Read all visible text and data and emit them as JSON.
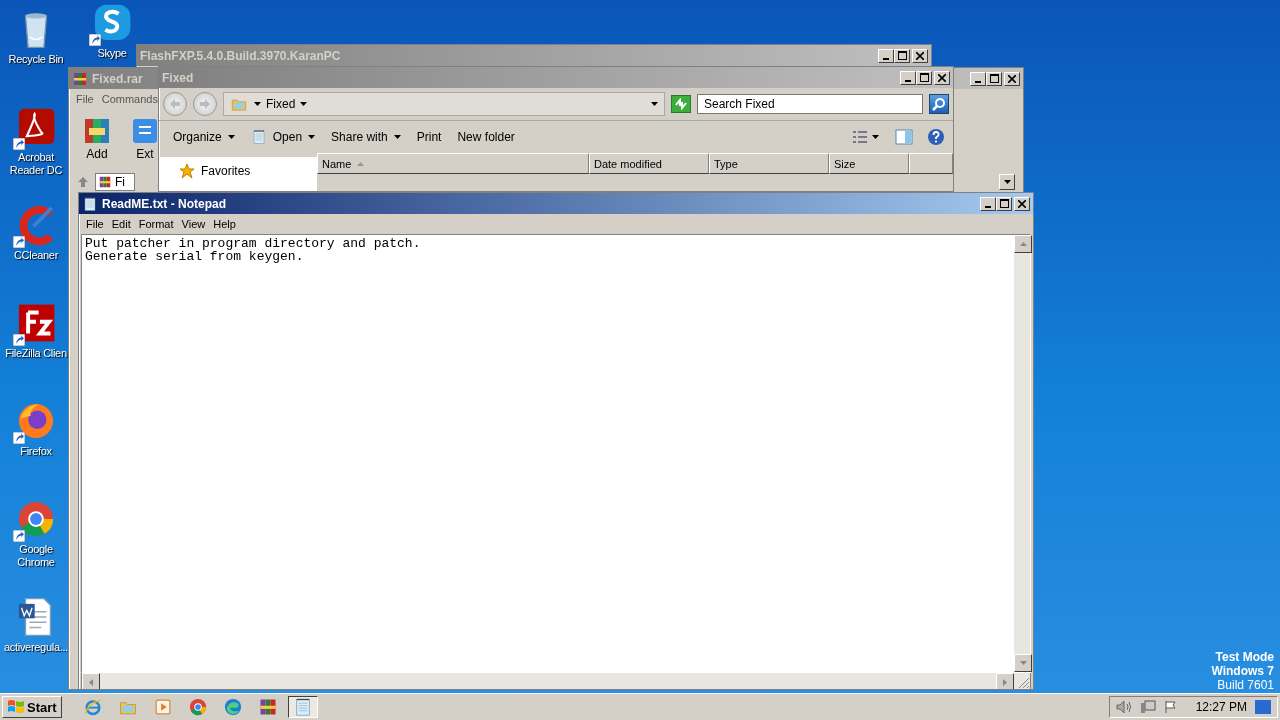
{
  "desktop_icons": [
    {
      "label": "Recycle Bin",
      "kind": "recycle-bin",
      "shortcut": false
    },
    {
      "label": "Skype",
      "kind": "skype",
      "shortcut": true
    },
    {
      "label": "Acrobat Reader DC",
      "kind": "acrobat",
      "shortcut": true
    },
    {
      "label": "CCleaner",
      "kind": "ccleaner",
      "shortcut": true
    },
    {
      "label": "FileZilla Clien",
      "kind": "filezilla",
      "shortcut": true
    },
    {
      "label": "Firefox",
      "kind": "firefox",
      "shortcut": true
    },
    {
      "label": "Google Chrome",
      "kind": "chrome",
      "shortcut": true
    },
    {
      "label": "activeregula...",
      "kind": "word",
      "shortcut": false
    }
  ],
  "flashfxp_window": {
    "title": "FlashFXP.5.4.0.Build.3970.KaranPC",
    "active": false
  },
  "winrar_window": {
    "title": "Fixed.rar",
    "active": false,
    "menu": [
      "File",
      "Commands"
    ],
    "toolbar": [
      {
        "label": "Add",
        "kind": "add"
      },
      {
        "label": "Ext",
        "kind": "extract"
      }
    ],
    "address": "Fi"
  },
  "explorer_window": {
    "title": "Fixed",
    "active": false,
    "breadcrumb": "Fixed",
    "search": {
      "placeholder": "Search Fixed"
    },
    "commands": [
      {
        "label": "Organize",
        "dropdown": true
      },
      {
        "label": "Open",
        "dropdown": true,
        "kind": "notepad"
      },
      {
        "label": "Share with",
        "dropdown": true
      },
      {
        "label": "Print",
        "dropdown": false
      },
      {
        "label": "New folder",
        "dropdown": false
      }
    ],
    "nav": [
      {
        "label": "Favorites"
      }
    ],
    "columns": [
      {
        "label": "Name",
        "sorted": true
      },
      {
        "label": "Date modified",
        "sorted": false
      },
      {
        "label": "Type",
        "sorted": false
      },
      {
        "label": "Size",
        "sorted": false
      }
    ]
  },
  "notepad_window": {
    "title": "ReadME.txt - Notepad",
    "active": true,
    "menu": [
      "File",
      "Edit",
      "Format",
      "View",
      "Help"
    ],
    "lines": [
      "Put patcher in program directory and patch.",
      "Generate serial from keygen."
    ]
  },
  "taskbar": {
    "start": "Start",
    "apps": [
      {
        "kind": "ie",
        "pressed": false
      },
      {
        "kind": "explorer",
        "pressed": false
      },
      {
        "kind": "media",
        "pressed": false
      },
      {
        "kind": "chrome",
        "pressed": false
      },
      {
        "kind": "edge",
        "pressed": false
      },
      {
        "kind": "winrar",
        "pressed": false
      },
      {
        "kind": "notepad",
        "pressed": true
      }
    ],
    "clock": "12:27 PM"
  },
  "os_notice": [
    "Test Mode",
    "Windows 7",
    "Build 7601"
  ]
}
